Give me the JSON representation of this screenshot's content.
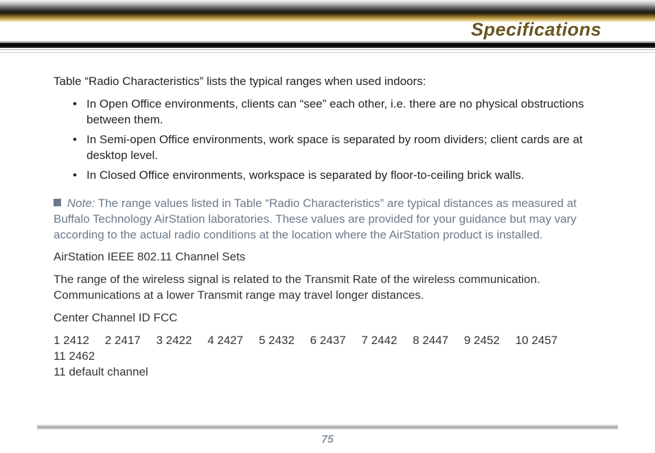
{
  "header": {
    "title": "Specifications"
  },
  "intro": "Table “Radio Characteristics” lists the typical ranges when used indoors:",
  "bullets": [
    "In Open Office environments, clients can “see” each other, i.e. there are no physical obstructions between them.",
    "In Semi-open Office environments, work space is separated by room dividers; client cards are at desktop level.",
    "In Closed Office environments, workspace is separated by floor-to-ceiling brick walls."
  ],
  "note": {
    "label": "Note:",
    "text": " The range values listed in Table “Radio Characteristics” are typical distances as measured at Buffalo Technology AirStation laboratories. These values are provided for your guidance but may vary according to the actual radio conditions at the location where the AirStation product is installed."
  },
  "channel_sets_title": "AirStation IEEE 802.11 Channel Sets",
  "range_desc": "The range of the wireless signal is related to the Transmit Rate of the wireless communication. Communications at a lower Transmit range may travel longer distances.",
  "center_label": "Center Channel ID FCC",
  "channels": [
    "1 2412",
    "2 2417",
    "3 2422",
    "4 2427",
    "5 2432",
    "6 2437",
    "7 2442",
    "8 2447",
    "9 2452",
    "10 2457",
    "11 2462"
  ],
  "default_channel": "11  default channel",
  "page_number": "75"
}
